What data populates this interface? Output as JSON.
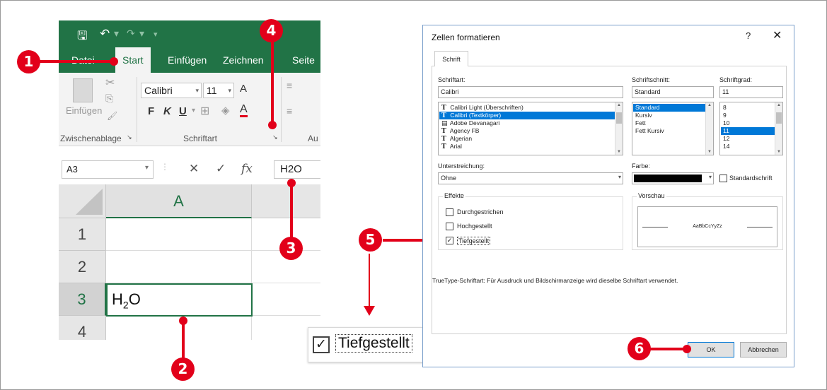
{
  "excel": {
    "tabs": [
      "Datei",
      "Start",
      "Einfügen",
      "Zeichnen",
      "Seite"
    ],
    "ribbon": {
      "paste_label": "Einfügen",
      "font_name": "Calibri",
      "font_size": "11",
      "bold": "F",
      "italic": "K",
      "underline": "U",
      "font_color_glyph": "A",
      "grow_glyph": "A",
      "group_clipboard": "Zwischenablage",
      "group_font": "Schriftart",
      "group_align_partial": "Au"
    },
    "name_box": "A3",
    "formula_value": "H2O",
    "columns": [
      "A"
    ],
    "rows": [
      "1",
      "2",
      "3",
      "4"
    ],
    "cell_a3": {
      "main": "H",
      "sub": "2",
      "tail": "O"
    }
  },
  "zoom_checkbox": {
    "checked": true,
    "label": "Tiefgestellt"
  },
  "callouts": [
    "1",
    "2",
    "3",
    "4",
    "5",
    "6"
  ],
  "dialog": {
    "title": "Zellen formatieren",
    "help": "?",
    "close": "✕",
    "tab": "Schrift",
    "font_label": "Schriftart:",
    "font_value": "Calibri",
    "fonts": [
      "Calibri Light (Überschriften)",
      "Calibri (Textkörper)",
      "Adobe Devanagari",
      "Agency FB",
      "Algerian",
      "Arial"
    ],
    "style_label": "Schriftschnitt:",
    "style_value": "Standard",
    "styles": [
      "Standard",
      "Kursiv",
      "Fett",
      "Fett Kursiv"
    ],
    "size_label": "Schriftgrad:",
    "size_value": "11",
    "sizes": [
      "8",
      "9",
      "10",
      "11",
      "12",
      "14"
    ],
    "underline_label": "Unterstreichung:",
    "underline_value": "Ohne",
    "color_label": "Farbe:",
    "standard_font_label": "Standardschrift",
    "effects_label": "Effekte",
    "effects": [
      {
        "label": "Durchgestrichen",
        "checked": false
      },
      {
        "label": "Hochgestellt",
        "checked": false
      },
      {
        "label": "Tiefgestellt",
        "checked": true
      }
    ],
    "preview_label": "Vorschau",
    "preview_text": "AaBbCcYyZz",
    "info_text": "TrueType-Schriftart: Für Ausdruck und Bildschirmanzeige wird dieselbe Schriftart verwendet.",
    "ok_label": "OK",
    "cancel_label": "Abbrechen"
  },
  "colors": {
    "excel_green": "#217346",
    "callout_red": "#e2001a",
    "selection_blue": "#0078d7"
  }
}
